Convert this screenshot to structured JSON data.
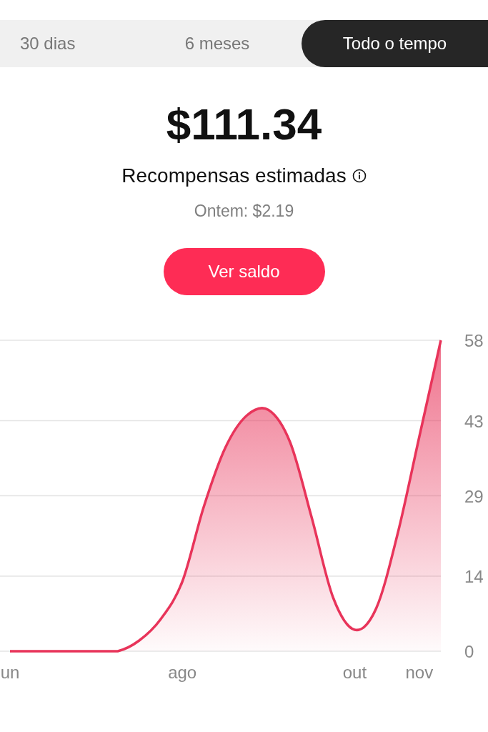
{
  "tabs": [
    {
      "label": "30 dias",
      "selected": false
    },
    {
      "label": "6 meses",
      "selected": false
    },
    {
      "label": "Todo o tempo",
      "selected": true
    }
  ],
  "summary": {
    "amount": "$111.34",
    "label": "Recompensas estimadas",
    "yesterday": "Ontem: $2.19",
    "button": "Ver saldo"
  },
  "chart": {
    "chart_data": {
      "type": "area",
      "categories": [
        "un",
        null,
        null,
        null,
        null,
        null,
        null,
        null,
        "ago",
        null,
        null,
        null,
        null,
        null,
        null,
        null,
        "out",
        null,
        null,
        "nov",
        null
      ],
      "series": [
        {
          "color": "#e8345a",
          "values": [
            0,
            0,
            0,
            0,
            0,
            0,
            2,
            6,
            13,
            27,
            38,
            44,
            45,
            39,
            25,
            10,
            4,
            8,
            22,
            40,
            58
          ]
        }
      ],
      "ylim": [
        0,
        58
      ],
      "grid": true,
      "yticks": [
        0,
        14,
        29,
        43,
        58
      ]
    }
  }
}
